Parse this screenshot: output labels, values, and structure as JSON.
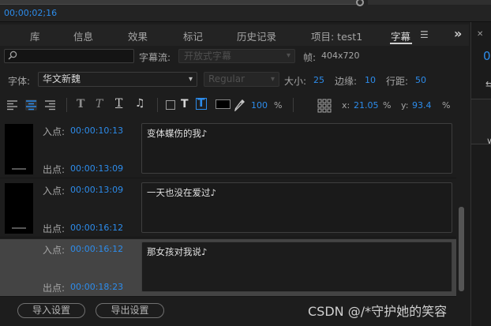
{
  "top": {
    "timecode": "00;00;02;16"
  },
  "tabs": [
    {
      "label": "库"
    },
    {
      "label": "信息"
    },
    {
      "label": "效果"
    },
    {
      "label": "标记"
    },
    {
      "label": "历史记录"
    },
    {
      "label": "项目: test1"
    },
    {
      "label": "字幕"
    }
  ],
  "toolbar_row1": {
    "search_placeholder": "",
    "stream_label": "字幕流:",
    "stream_value": "开放式字幕",
    "frame_label": "帧:",
    "frame_value": "404x720"
  },
  "toolbar_row2": {
    "font_label": "字体:",
    "font_value": "华文新魏",
    "style_value": "Regular",
    "size_label": "大小:",
    "size_value": "25",
    "edge_label": "边缘:",
    "edge_value": "10",
    "line_spacing_label": "行距:",
    "line_spacing_value": "50"
  },
  "toolbar_row3": {
    "opacity_value": "100",
    "opacity_unit": "%",
    "x_label": "x:",
    "x_value": "21.05",
    "x_unit": "%",
    "y_label": "y:",
    "y_value": "93.4",
    "y_unit": "%"
  },
  "captions": [
    {
      "in_label": "入点:",
      "in_time": "00:00:10:13",
      "out_label": "出点:",
      "out_time": "00:00:13:09",
      "text": "变体蝶伤的我♪",
      "selected": false
    },
    {
      "in_label": "入点:",
      "in_time": "00:00:13:09",
      "out_label": "出点:",
      "out_time": "00:00:16:12",
      "text": "一天也没在爱过♪",
      "selected": false
    },
    {
      "in_label": "入点:",
      "in_time": "00:00:16:12",
      "out_label": "出点:",
      "out_time": "00:00:18:23",
      "text": "那女孩对我说♪",
      "selected": true
    }
  ],
  "bottom": {
    "import_label": "导入设置",
    "export_label": "导出设置"
  },
  "right_panel": {
    "digit": "0"
  },
  "watermark": "CSDN @/*守护她的笑容",
  "colors": {
    "accent": "#2d8ceb",
    "panel_bg": "#1d1d1d",
    "selected_row": "#444444"
  }
}
